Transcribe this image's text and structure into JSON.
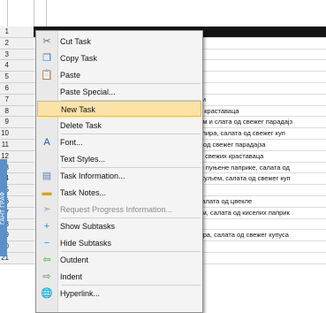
{
  "rows": [
    {
      "num": "1",
      "text": "",
      "dark": true
    },
    {
      "num": "2",
      "text": ""
    },
    {
      "num": "3",
      "text": "ени"
    },
    {
      "num": "4",
      "text": "ада"
    },
    {
      "num": "5",
      "text": ""
    },
    {
      "num": "6",
      "text": ""
    },
    {
      "num": "7",
      "text": "свежи"
    },
    {
      "num": "8",
      "text": "ежих краставаца"
    },
    {
      "num": "9",
      "text": "месом и слата од свежег парадајз"
    },
    {
      "num": "10",
      "text": "кромпира, салата од свежег куп"
    },
    {
      "num": "11",
      "text": "лата од свежег парадајза"
    },
    {
      "num": "12",
      "text": "та од свежих краставаца"
    },
    {
      "num": "13",
      "text": "пир и пуњене паприке, салата од"
    },
    {
      "num": "14",
      "text": "м пасуљем, салата од свежег куп"
    },
    {
      "num": "15",
      "text": ""
    },
    {
      "num": "16",
      "text": "ир, салата од цвекле"
    },
    {
      "num": "17",
      "text": "пиром, салата од киселих паприк"
    },
    {
      "num": "18",
      "text": ""
    },
    {
      "num": "19",
      "text": "омпира, салата од свежег купуса"
    },
    {
      "num": "20",
      "text": ""
    },
    {
      "num": "21",
      "text": ""
    }
  ],
  "menu": {
    "items": [
      {
        "label": "Cut Task",
        "icon": "scissors-icon",
        "glyph": "✂"
      },
      {
        "label": "Copy Task",
        "icon": "copy-icon",
        "glyph": "❐"
      },
      {
        "label": "Paste",
        "icon": "paste-icon",
        "glyph": "📋"
      },
      {
        "label": "Paste Special...",
        "icon": "",
        "glyph": ""
      },
      {
        "label": "New Task",
        "icon": "",
        "glyph": "",
        "highlighted": true
      },
      {
        "label": "Delete Task",
        "icon": "",
        "glyph": ""
      },
      {
        "label": "Font...",
        "icon": "font-icon",
        "glyph": "A"
      },
      {
        "label": "Text Styles...",
        "icon": "",
        "glyph": ""
      },
      {
        "label": "Task Information...",
        "icon": "task-info-icon",
        "glyph": "▤"
      },
      {
        "label": "Task Notes...",
        "icon": "task-notes-icon",
        "glyph": "▬"
      },
      {
        "label": "Request Progress Information...",
        "icon": "request-progress-icon",
        "glyph": "➣",
        "disabled": true
      },
      {
        "label": "Show Subtasks",
        "icon": "plus-icon",
        "glyph": "+"
      },
      {
        "label": "Hide Subtasks",
        "icon": "minus-icon",
        "glyph": "−"
      },
      {
        "label": "Outdent",
        "icon": "outdent-arrow-icon",
        "glyph": "⇦"
      },
      {
        "label": "Indent",
        "icon": "indent-arrow-icon",
        "glyph": "⇨"
      },
      {
        "label": "Hyperlink...",
        "icon": "hyperlink-icon",
        "glyph": "🌐"
      }
    ]
  },
  "side_strip_label": "ГАНТ ГРАФ"
}
